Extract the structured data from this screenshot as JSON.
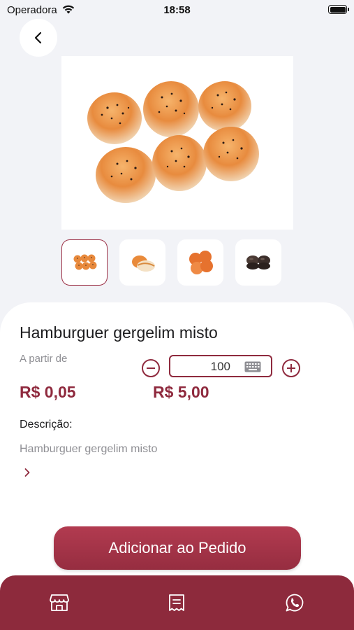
{
  "status_bar": {
    "carrier": "Operadora",
    "time": "18:58",
    "icons": [
      "wifi-icon",
      "battery-icon"
    ]
  },
  "navigation": {
    "back_icon": "chevron-left-icon"
  },
  "product": {
    "title": "Hamburguer gergelim misto",
    "price_prefix": "A partir de",
    "unit_price": "R$ 0,05",
    "total_price": "R$ 5,00",
    "quantity": "100",
    "description_label": "Descrição:",
    "description": "Hamburguer gergelim misto",
    "gallery": {
      "selected_index": 0,
      "thumbnails": [
        "sesame-buns-thumb",
        "bread-roll-thumb",
        "orange-buns-thumb",
        "dark-buns-thumb"
      ]
    }
  },
  "actions": {
    "add_to_order": "Adicionar ao Pedido"
  },
  "tab_bar": {
    "items": [
      "store-icon",
      "order-list-icon",
      "whatsapp-icon"
    ]
  },
  "colors": {
    "accent": "#8f2a3e",
    "button": "#a63447",
    "tab_bar": "#8d2a3c",
    "background": "#f2f3f7"
  }
}
